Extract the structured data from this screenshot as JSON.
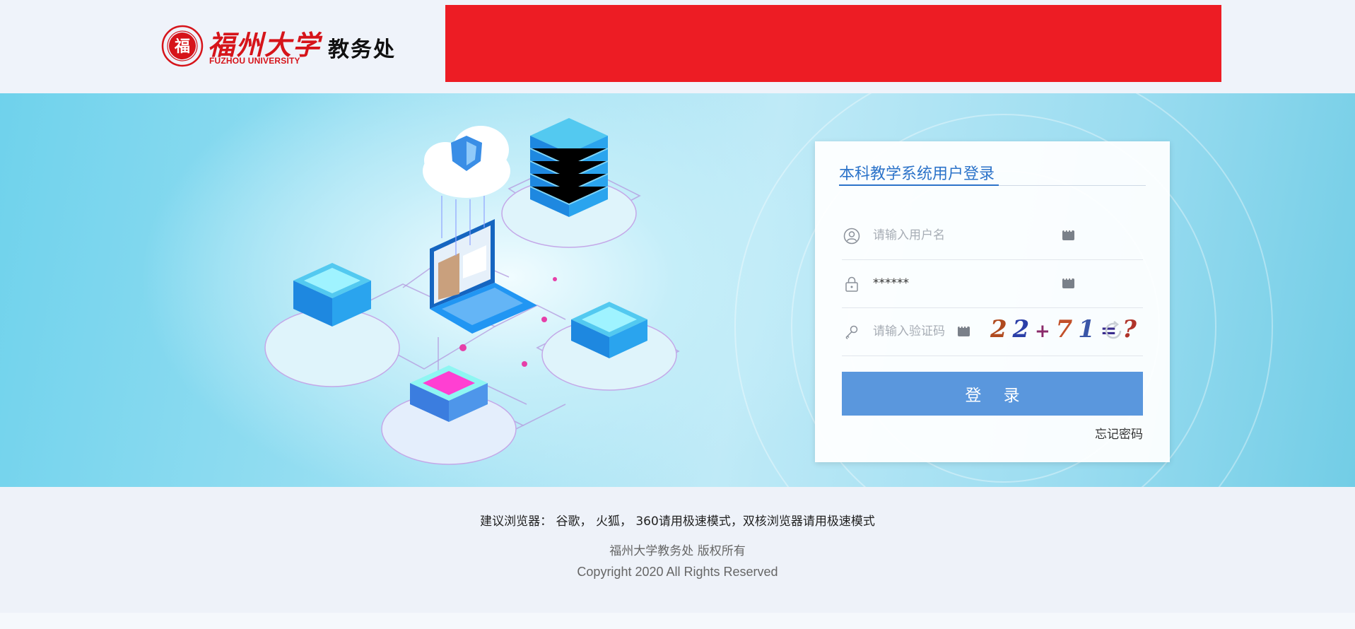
{
  "header": {
    "logo_cn": "福州大学",
    "logo_en": "FUZHOU UNIVERSITY",
    "seal_char": "福",
    "dept_name": "教务处"
  },
  "login": {
    "title": "本科教学系统用户登录",
    "username_placeholder": "请输入用户名",
    "password_value": "******",
    "captcha_placeholder": "请输入验证码",
    "captcha_chars": [
      "2",
      "2",
      "+",
      "7",
      "1",
      "=",
      "?"
    ],
    "captcha_colors": [
      "#b04a1e",
      "#2b3fa8",
      "#8a2a6a",
      "#c2502a",
      "#3a56a8",
      "#3a2c8e",
      "#b0342a"
    ],
    "login_button": "登 录",
    "forgot_password": "忘记密码"
  },
  "footer": {
    "browser_tip": "建议浏览器： 谷歌， 火狐， 360请用极速模式，双核浏览器请用极速模式",
    "copyright_cn": "福州大学教务处 版权所有",
    "copyright_en": "Copyright 2020 All Rights Reserved"
  },
  "colors": {
    "brand_red": "#d6141a",
    "banner_red": "#ed1c24",
    "accent_blue": "#2c73c9",
    "button_blue": "#5a97dd"
  }
}
